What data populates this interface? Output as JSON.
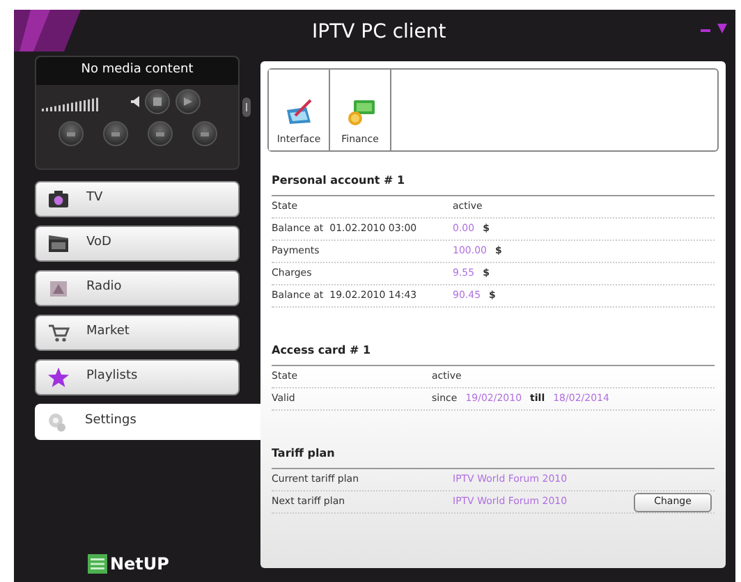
{
  "window": {
    "title": "IPTV PC client"
  },
  "player": {
    "display": "No media content",
    "volume": {
      "level": 0.7
    }
  },
  "sidebar": {
    "items": [
      {
        "label": "TV",
        "selected": false
      },
      {
        "label": "VoD",
        "selected": false
      },
      {
        "label": "Radio",
        "selected": false
      },
      {
        "label": "Market",
        "selected": false
      },
      {
        "label": "Playlists",
        "selected": false
      },
      {
        "label": "Settings",
        "selected": true
      }
    ]
  },
  "tabs": [
    {
      "label": "Interface"
    },
    {
      "label": "Finance"
    }
  ],
  "sections": [
    {
      "title": "Personal account # 1",
      "rows": [
        {
          "label": "State",
          "parts": [
            {
              "kind": "plain",
              "text": "active"
            }
          ]
        },
        {
          "label": "Balance at  01.02.2010 03:00",
          "parts": [
            {
              "kind": "accent",
              "text": "0.00"
            },
            {
              "kind": "unit",
              "text": "$"
            }
          ]
        },
        {
          "label": "Payments",
          "parts": [
            {
              "kind": "accent",
              "text": "100.00"
            },
            {
              "kind": "unit",
              "text": "$"
            }
          ]
        },
        {
          "label": "Charges",
          "parts": [
            {
              "kind": "accent",
              "text": "9.55"
            },
            {
              "kind": "unit",
              "text": "$"
            }
          ]
        },
        {
          "label": "Balance at  19.02.2010 14:43",
          "parts": [
            {
              "kind": "accent",
              "text": "90.45"
            },
            {
              "kind": "unit",
              "text": "$"
            }
          ]
        }
      ]
    },
    {
      "title": "Access card # 1",
      "rows": [
        {
          "label": "State",
          "parts": [
            {
              "kind": "plain",
              "text": "active"
            }
          ]
        },
        {
          "label": "Valid",
          "parts": [
            {
              "kind": "plain",
              "text": "since"
            },
            {
              "kind": "accent",
              "text": "19/02/2010"
            },
            {
              "kind": "strong",
              "text": "till"
            },
            {
              "kind": "accent",
              "text": "18/02/2014"
            }
          ]
        }
      ]
    },
    {
      "title": "Tariff plan",
      "rows": [
        {
          "label": "Current tariff plan",
          "parts": [
            {
              "kind": "accent",
              "text": "IPTV World Forum 2010"
            }
          ]
        },
        {
          "label": "Next tariff plan",
          "parts": [
            {
              "kind": "accent",
              "text": "IPTV World Forum 2010"
            }
          ],
          "button": "Change"
        }
      ]
    }
  ],
  "logo": "NetUP"
}
